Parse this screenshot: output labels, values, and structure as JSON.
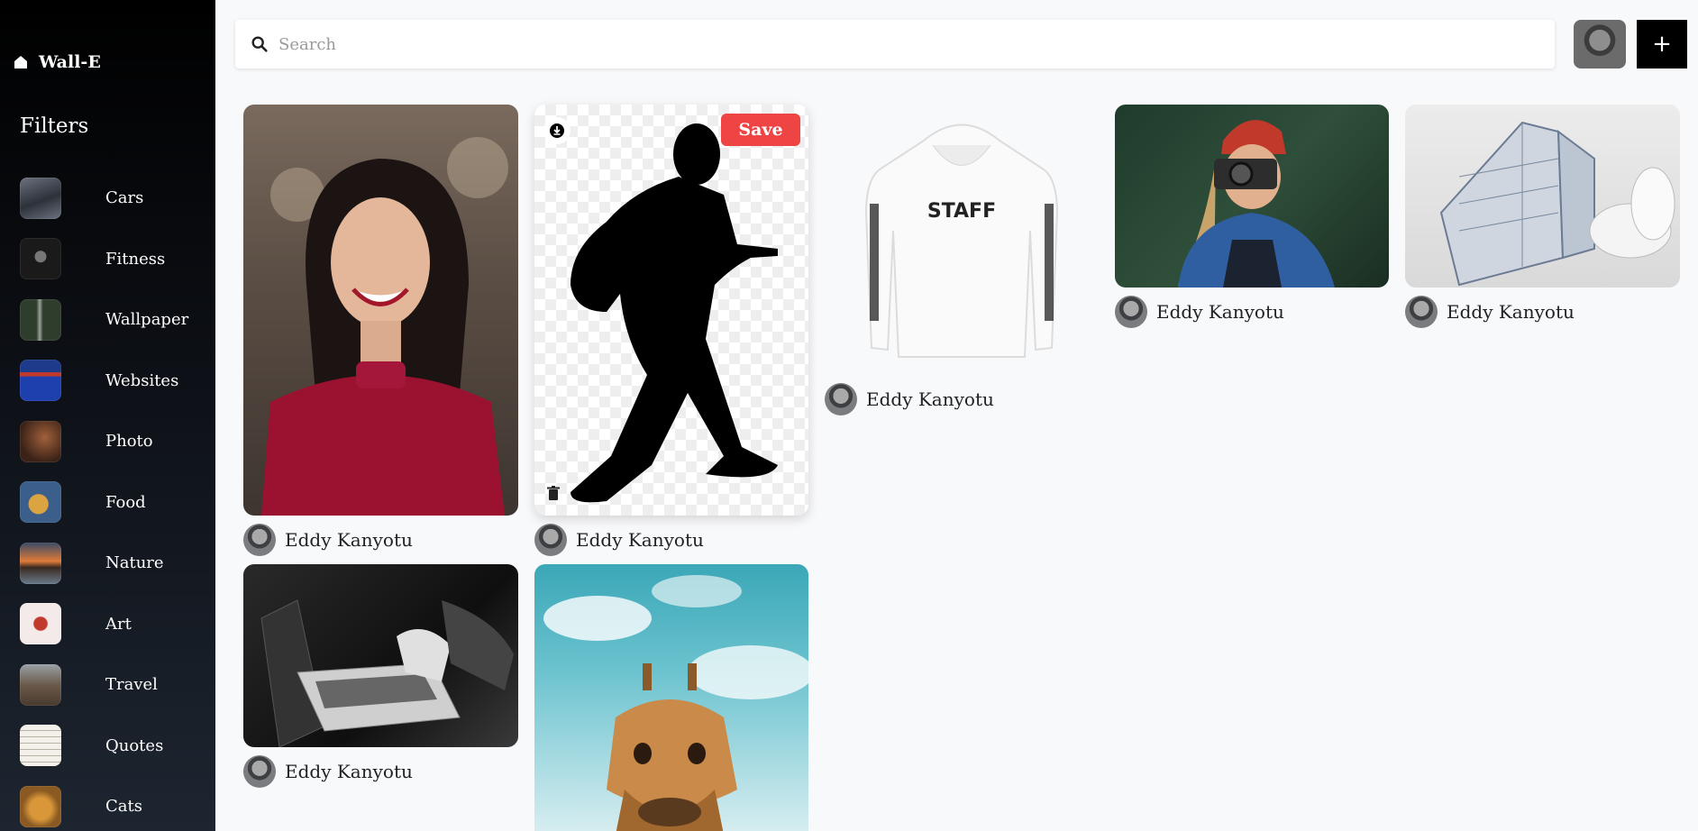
{
  "brand": {
    "name": "Wall-E",
    "icon": "home-icon"
  },
  "sidebar": {
    "filters_title": "Filters",
    "items": [
      {
        "label": "Cars",
        "color": "#4b5563"
      },
      {
        "label": "Fitness",
        "color": "#2b2b2b"
      },
      {
        "label": "Wallpaper",
        "color": "#3c4a3a"
      },
      {
        "label": "Websites",
        "color": "#1e3a8a"
      },
      {
        "label": "Photo",
        "color": "#4a2e22"
      },
      {
        "label": "Food",
        "color": "#7a5a2a"
      },
      {
        "label": "Nature",
        "color": "#9a6a3a"
      },
      {
        "label": "Art",
        "color": "#f3e8e8"
      },
      {
        "label": "Travel",
        "color": "#6b5a4a"
      },
      {
        "label": "Quotes",
        "color": "#f4f1ea"
      },
      {
        "label": "Cats",
        "color": "#b07a2a"
      }
    ]
  },
  "search": {
    "placeholder": "Search",
    "value": ""
  },
  "header": {
    "add_label": "+"
  },
  "pins": [
    {
      "author": "Eddy Kanyotu"
    },
    {
      "author": "Eddy Kanyotu",
      "save_label": "Save"
    },
    {
      "author": "Eddy Kanyotu"
    },
    {
      "author": "Eddy Kanyotu"
    },
    {
      "author": "Eddy Kanyotu"
    },
    {
      "author": "Eddy Kanyotu"
    },
    {
      "author": ""
    }
  ],
  "hoodie_text": "STAFF",
  "colors": {
    "accent": "#ef4444",
    "sidebar_top": "#000000",
    "sidebar_bottom": "#1d2530"
  }
}
